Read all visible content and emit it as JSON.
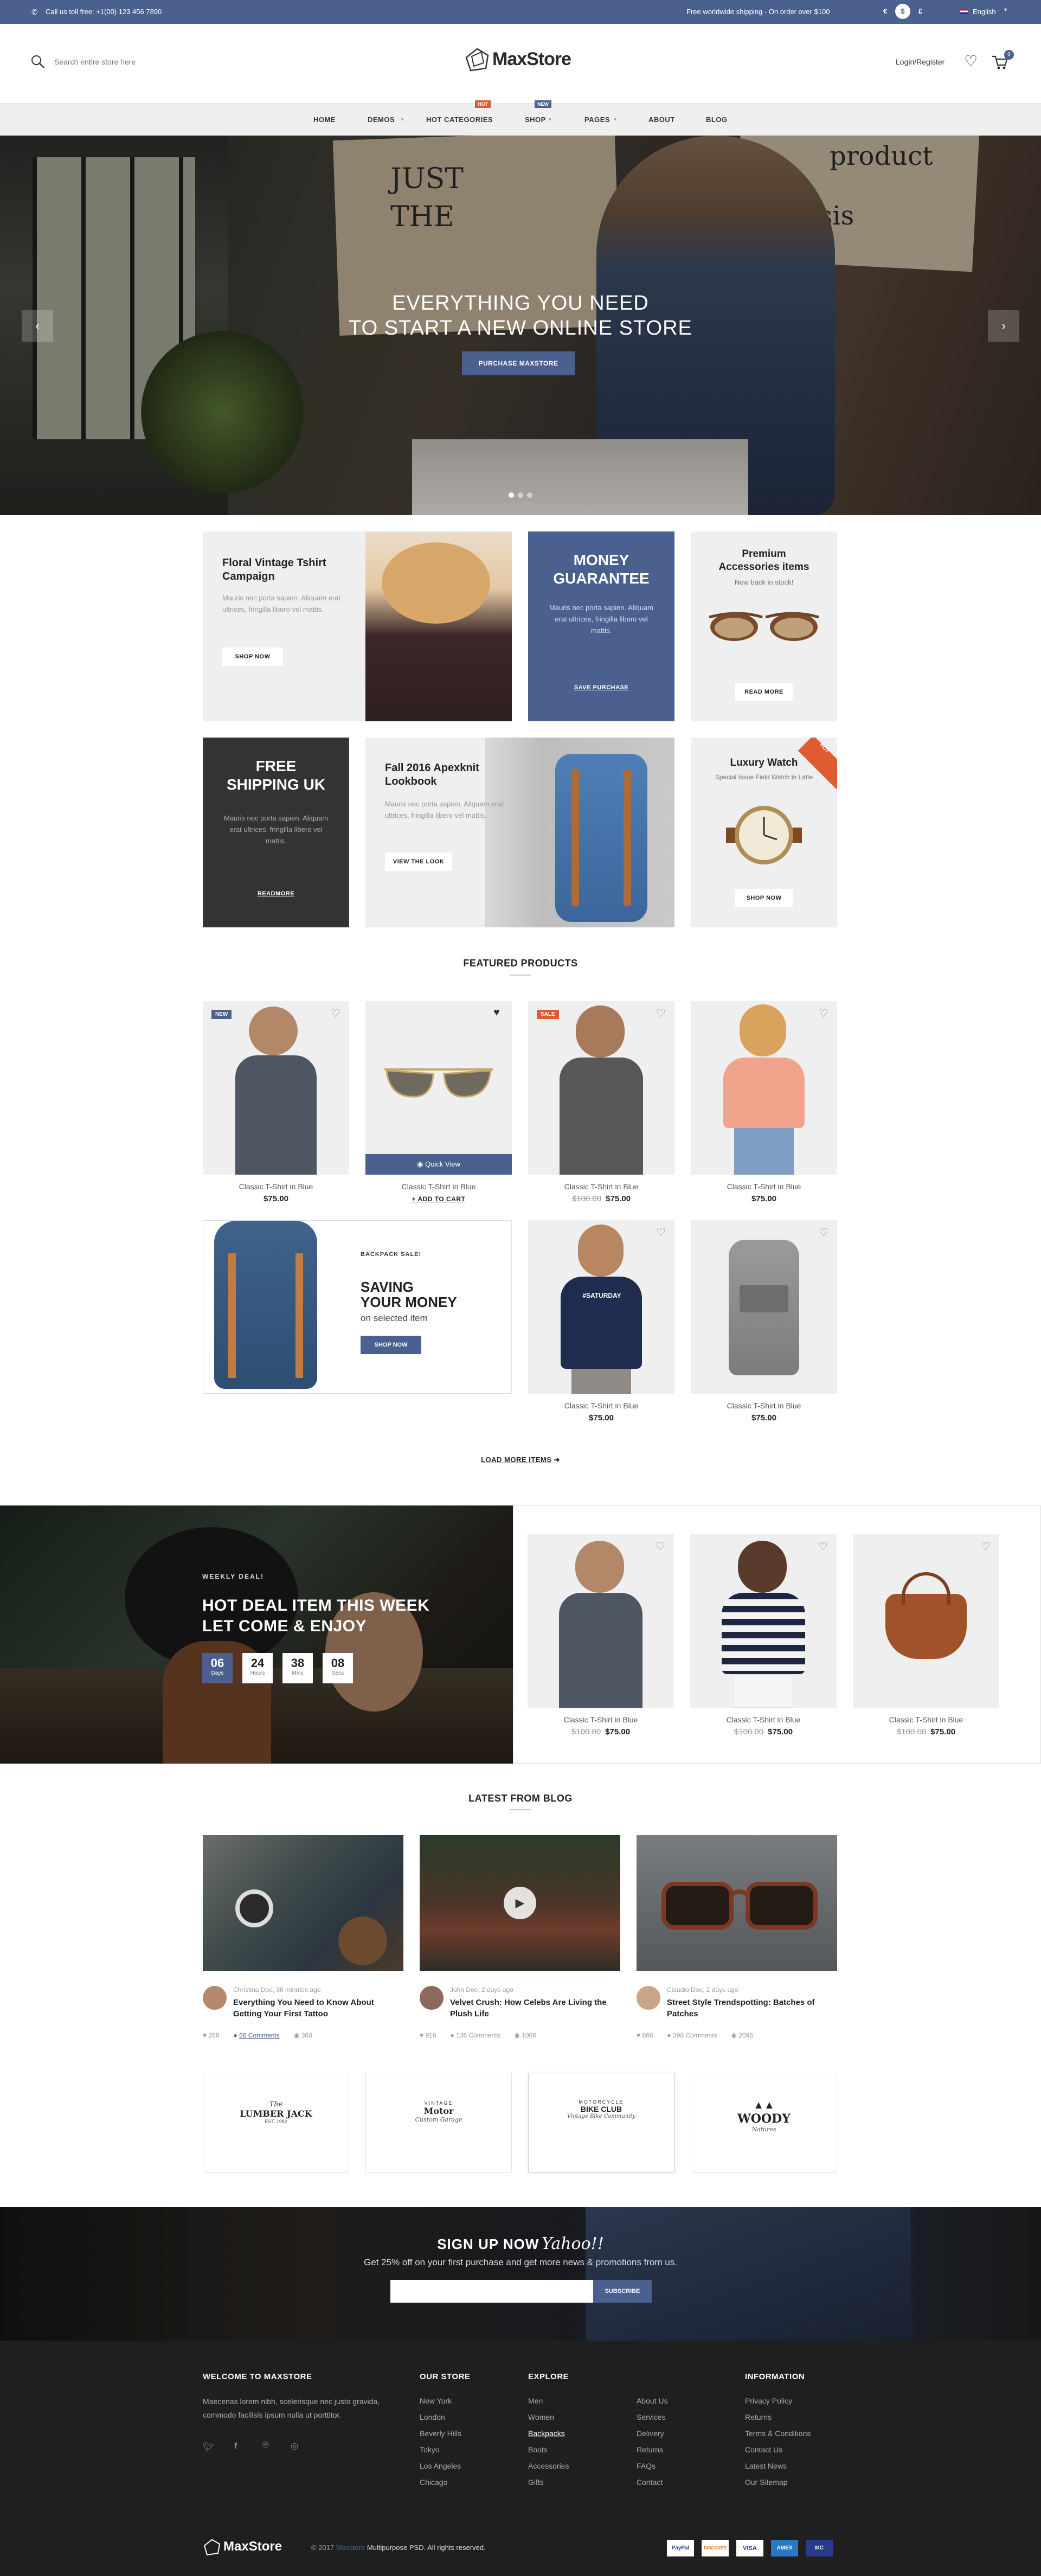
{
  "topbar": {
    "phone": "Call us toll free: +1(00) 123 456 7890",
    "shipping": "Free worldwide shipping - On order over $100",
    "currencies": [
      "€",
      "$",
      "£"
    ],
    "language": "English"
  },
  "header": {
    "search_placeholder": "Search entire store here",
    "logo": "MaxStore",
    "login": "Login/Register",
    "cart_count": "0"
  },
  "nav": {
    "items": [
      "HOME",
      "DEMOS",
      "HOT CATEGORIES",
      "SHOP",
      "PAGES",
      "ABOUT",
      "BLOG"
    ],
    "hot_tag": "HOT",
    "new_tag": "NEW"
  },
  "hero": {
    "line1": "EVERYTHING YOU NEED",
    "line2": "TO START A NEW ONLINE STORE",
    "button": "PURCHASE MAXSTORE",
    "poster_text": [
      "JUST",
      "THE",
      "product",
      "analysis"
    ]
  },
  "promos": {
    "floral": {
      "title": "Floral Vintage Tshirt Campaign",
      "text": "Mauris nec porta sapien. Aliquam erat ultrices, fringilla libero vel mattis.",
      "button": "SHOP NOW"
    },
    "money": {
      "title": "MONEY GUARANTEE",
      "text": "Mauris nec porta sapien. Aliquam erat ultrices, fringilla libero vel mattis.",
      "button": "SAVE PURCHASE"
    },
    "premium": {
      "title": "Premium Accessories items",
      "subtitle": "Now back in stock!",
      "button": "READ MORE"
    },
    "shipping": {
      "title": "FREE SHIPPING UK",
      "text": "Mauris nec porta sapien. Aliquam erat ultrices, fringilla libero vel mattis.",
      "button": "READMORE"
    },
    "fall": {
      "title": "Fall 2016 Apexknit Lookbook",
      "text": "Mauris nec porta sapien. Aliquam erat ultrices, fringilla libero vel mattis.",
      "button": "VIEW THE LOOK"
    },
    "watch": {
      "title": "Luxury Watch",
      "subtitle": "Special Issue Field Watch in Latte",
      "button": "SHOP NOW",
      "tag": "HOT"
    }
  },
  "featured": {
    "title": "FEATURED PRODUCTS",
    "quick_view": "Quick View",
    "add_to_cart": "+ ADD TO CART",
    "new_badge": "NEW",
    "sale_badge": "SALE",
    "products": [
      {
        "name": "Classic T-Shirt in Blue",
        "price": "$75.00",
        "old": ""
      },
      {
        "name": "Classic T-Shirt in Blue",
        "price": "",
        "old": ""
      },
      {
        "name": "Classic T-Shirt in Blue",
        "price": "$75.00",
        "old": "$100.00"
      },
      {
        "name": "Classic T-Shirt in Blue",
        "price": "$75.00",
        "old": ""
      },
      {
        "name": "Classic T-Shirt in Blue",
        "price": "$75.00",
        "old": ""
      },
      {
        "name": "Classic T-Shirt in Blue",
        "price": "$75.00",
        "old": ""
      }
    ],
    "backpack": {
      "small": "BACKPACK SALE!",
      "title1": "SAVING",
      "title2": "YOUR MONEY",
      "sub": "on selected item",
      "button": "SHOP NOW"
    },
    "load_more": "LOAD MORE ITEMS"
  },
  "deal": {
    "small": "WEEKLY DEAL!",
    "title1": "HOT DEAL ITEM THIS WEEK",
    "title2": "LET COME & ENJOY",
    "countdown": [
      {
        "v": "06",
        "l": "Days"
      },
      {
        "v": "24",
        "l": "Hours"
      },
      {
        "v": "38",
        "l": "Mins"
      },
      {
        "v": "08",
        "l": "Secs"
      }
    ],
    "products": [
      {
        "name": "Classic T-Shirt in Blue",
        "price": "$75.00",
        "old": "$100.00"
      },
      {
        "name": "Classic T-Shirt in Blue",
        "price": "$75.00",
        "old": "$100.00"
      },
      {
        "name": "Classic T-Shirt in Blue",
        "price": "$75.00",
        "old": "$100.00"
      }
    ]
  },
  "blog": {
    "title": "LATEST FROM BLOG",
    "posts": [
      {
        "meta": "Christina Doe, 36 minutes ago",
        "title": "Everything You Need to Know About Getting Your First Tattoo",
        "likes": "268",
        "comments": "66 Comments",
        "views": "368"
      },
      {
        "meta": "John Doe, 2 days ago",
        "title": "Velvet Crush: How Celebs Are Living the Plush Life",
        "likes": "916",
        "comments": "136 Comments",
        "views": "1066"
      },
      {
        "meta": "Claudio Doe, 2 days ago",
        "title": "Street Style Trendspotting: Batches of Patches",
        "likes": "866",
        "comments": "398 Comments",
        "views": "2096"
      }
    ]
  },
  "brands": [
    {
      "a": "The",
      "b": "LUMBER JACK",
      "c": "EST. 1982"
    },
    {
      "a": "VINTAGE",
      "b": "Motor",
      "c": "Custom Garage"
    },
    {
      "a": "MOTORCYCLE",
      "b": "BIKE CLUB",
      "c": "Vintage Bike Community"
    },
    {
      "a": "",
      "b": "WOODY",
      "c": "Natures"
    }
  ],
  "newsletter": {
    "title": "SIGN UP NOW",
    "title_script": "Yahoo!!",
    "text": "Get 25% off on your first purchase and get more news & promotions from us.",
    "button": "SUBSCRIBE"
  },
  "footer": {
    "welcome_title": "WELCOME TO MAXSTORE",
    "welcome_text": "Maecenas lorem nibh, scelerisque nec justo gravida, commodo facilisis ipsum nulla ut porttitor.",
    "store_title": "OUR STORE",
    "stores": [
      "New York",
      "London",
      "Beverly Hills",
      "Tokyo",
      "Los Angeles",
      "Chicago"
    ],
    "explore_title": "EXPLORE",
    "explore1": [
      "Men",
      "Women",
      "Backpacks",
      "Boots",
      "Accessories",
      "Gifts"
    ],
    "explore2": [
      "About Us",
      "Services",
      "Delivery",
      "Returns",
      "FAQs",
      "Contact"
    ],
    "info_title": "INFORMATION",
    "info": [
      "Privacy Policy",
      "Returns",
      "Terms & Conditions",
      "Contact Us",
      "Latest News",
      "Our Sitemap"
    ],
    "logo": "MaxStore",
    "copy_pre": "© 2017 ",
    "copy_brand": "Maxstore",
    "copy_post": " Multipurpose PSD. All rights reserved.",
    "payments": [
      "PayPal",
      "DISCOVER",
      "VISA",
      "AMEX",
      "MC"
    ]
  }
}
